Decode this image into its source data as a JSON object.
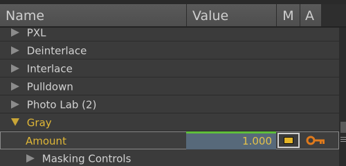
{
  "header": {
    "name": "Name",
    "value": "Value",
    "m": "M",
    "a": "A"
  },
  "rows": [
    {
      "label": "PXL"
    },
    {
      "label": "Deinterlace"
    },
    {
      "label": "Interlace"
    },
    {
      "label": "Pulldown"
    },
    {
      "label": "Photo Lab (2)"
    },
    {
      "label": "Gray"
    },
    {
      "label": "Masking Controls"
    }
  ],
  "amount": {
    "label": "Amount",
    "value": "1.000"
  },
  "colors": {
    "accent_yellow": "#e0b737",
    "value_cell": "#57697a",
    "value_bar": "#5fbf3a"
  },
  "icons": [
    "expand-triangle-icon",
    "collapse-triangle-icon",
    "keyframe-key-icon",
    "checkbox-icon"
  ]
}
